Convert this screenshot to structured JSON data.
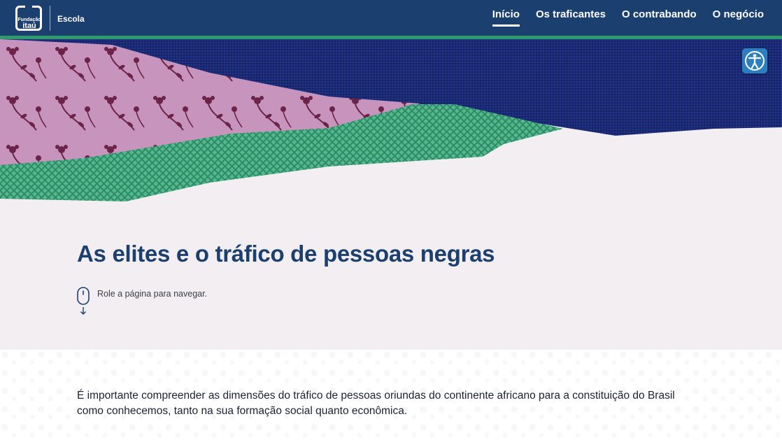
{
  "header": {
    "logo_line1": "Fundação",
    "logo_line2": "itaú",
    "brand_label": "Escola",
    "nav": [
      {
        "label": "Início",
        "active": true
      },
      {
        "label": "Os traficantes",
        "active": false
      },
      {
        "label": "O contrabando",
        "active": false
      },
      {
        "label": "O negócio",
        "active": false
      }
    ]
  },
  "accessibility_button": {
    "icon": "accessibility-icon"
  },
  "hero": {
    "colors": {
      "navy": "#1a2a74",
      "pink": "#c794bd",
      "green": "#3fa27b",
      "flower": "#6b2347"
    }
  },
  "main": {
    "title": "As elites e o tráfico de pessoas negras",
    "scroll_hint": "Role a página para navegar.",
    "scroll_icon": "mouse-scroll-icon"
  },
  "content": {
    "intro": "É importante compreender as dimensões do tráfico de pessoas oriundas do continente africano para a constituição do Brasil como conhecemos, tanto na sua formação social quanto econômica."
  },
  "colors": {
    "header_bg": "#1b3f6e",
    "accent": "#2f9b6d",
    "title": "#1b3f6e",
    "page_bg": "#f2eef1"
  }
}
